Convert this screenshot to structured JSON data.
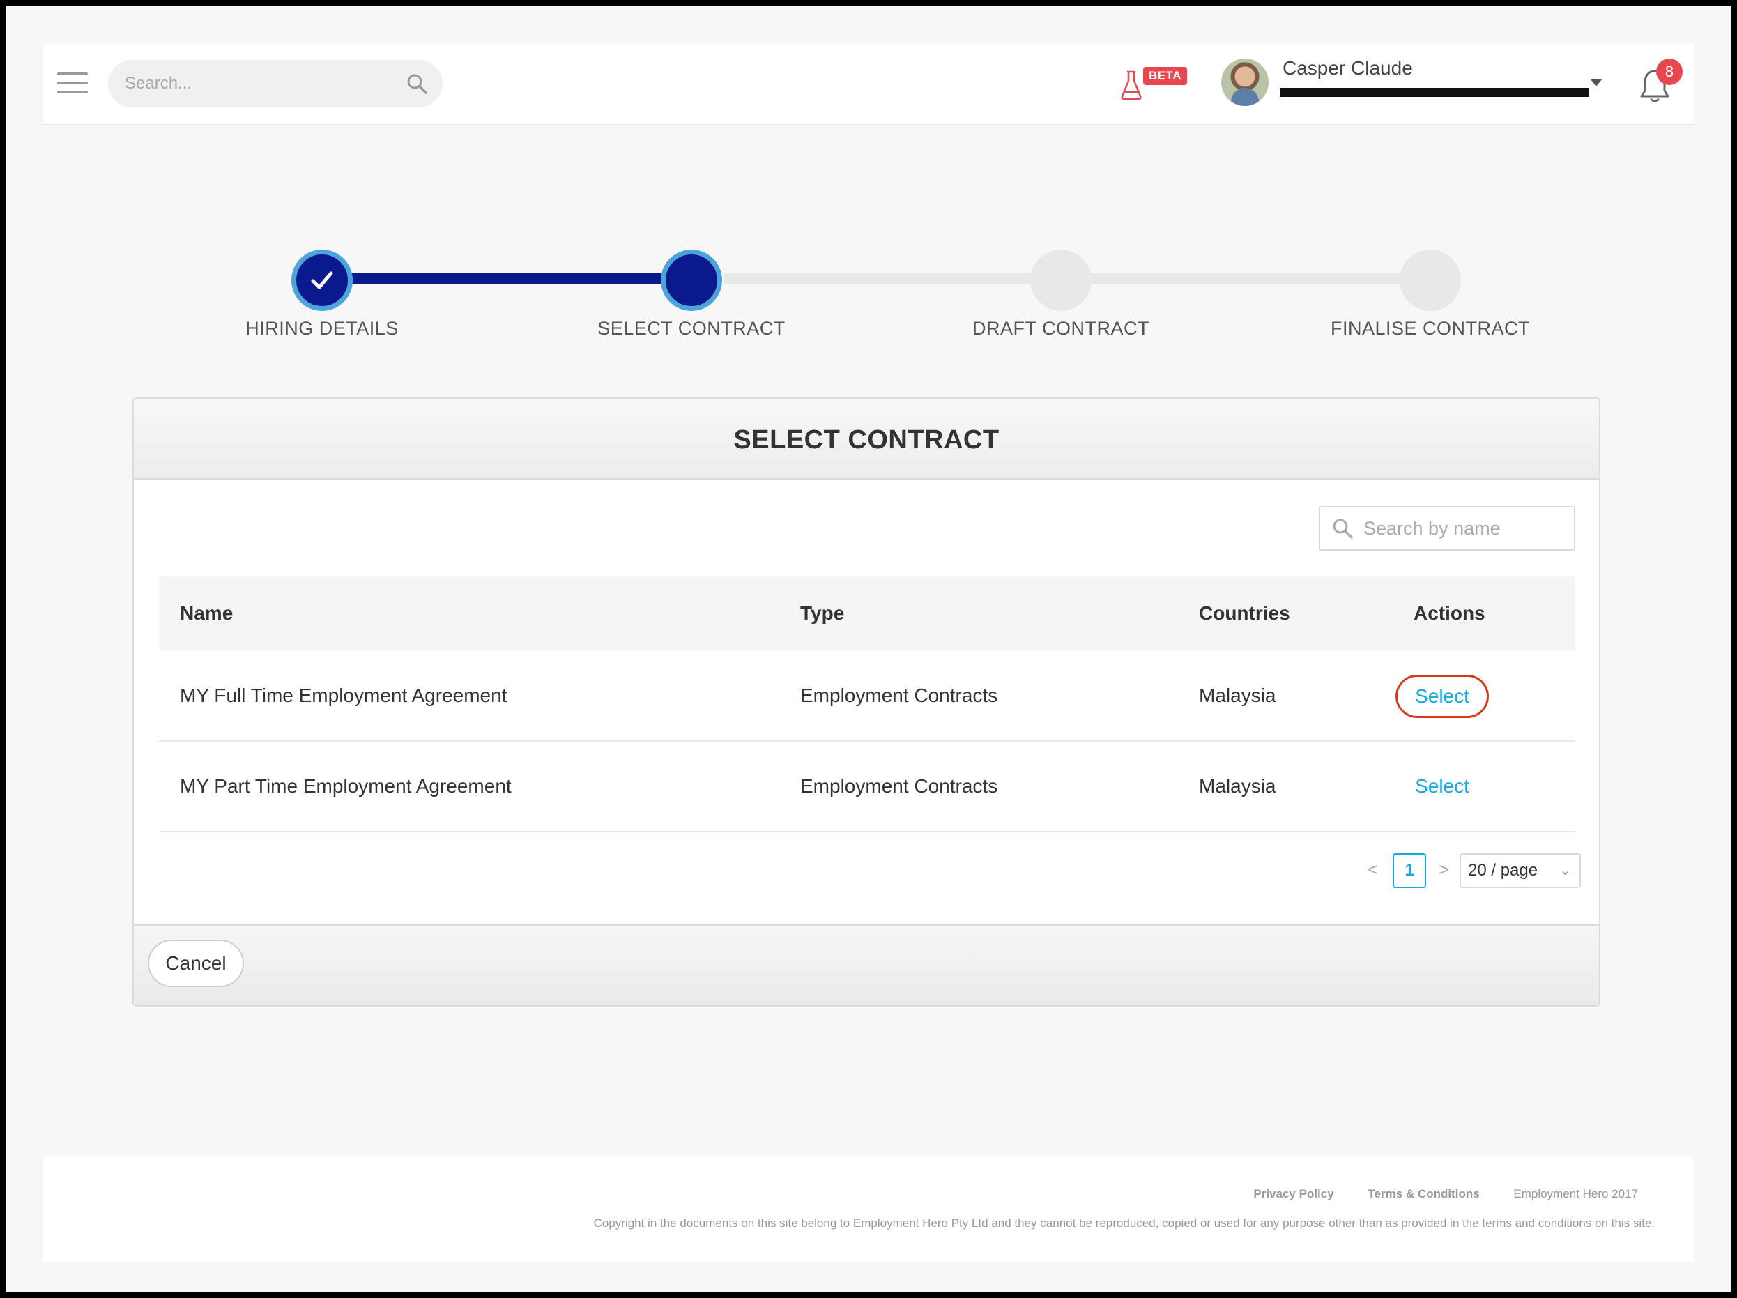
{
  "header": {
    "search_placeholder": "Search...",
    "beta_label": "BETA",
    "user_name": "Casper Claude",
    "notification_count": "8"
  },
  "stepper": {
    "steps": [
      {
        "label": "HIRING DETAILS",
        "state": "done"
      },
      {
        "label": "SELECT CONTRACT",
        "state": "active"
      },
      {
        "label": "DRAFT CONTRACT",
        "state": "pending"
      },
      {
        "label": "FINALISE CONTRACT",
        "state": "pending"
      }
    ]
  },
  "card": {
    "title": "SELECT CONTRACT",
    "search_placeholder": "Search by name",
    "columns": {
      "name": "Name",
      "type": "Type",
      "countries": "Countries",
      "actions": "Actions"
    },
    "rows": [
      {
        "name": "MY Full Time Employment Agreement",
        "type": "Employment Contracts",
        "countries": "Malaysia",
        "action": "Select"
      },
      {
        "name": "MY Part Time Employment Agreement",
        "type": "Employment Contracts",
        "countries": "Malaysia",
        "action": "Select"
      }
    ],
    "pagination": {
      "prev": "<",
      "current": "1",
      "next": ">",
      "page_size": "20 / page"
    },
    "cancel_label": "Cancel"
  },
  "footer": {
    "privacy": "Privacy Policy",
    "terms": "Terms & Conditions",
    "brand": "Employment Hero 2017",
    "copyright": "Copyright in the documents on this site belong to Employment Hero Pty Ltd and they cannot be reproduced, copied or used for any purpose other than as provided in the terms and conditions on this site."
  },
  "colors": {
    "step_done": "#0a1a8c",
    "step_ring": "#4da3dc",
    "link": "#18a8e0",
    "badge": "#e8474f",
    "highlight": "#d6391c"
  },
  "icons": [
    "hamburger-icon",
    "search-icon",
    "flask-icon",
    "chevron-down-icon",
    "bell-icon",
    "check-icon"
  ]
}
